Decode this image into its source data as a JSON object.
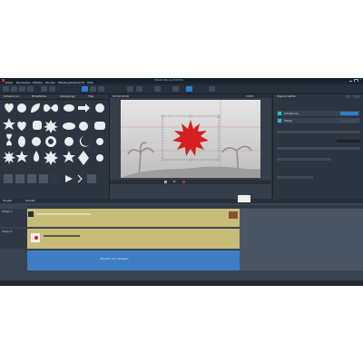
{
  "window": {
    "title": "MAGIX Movie Edit Pro"
  },
  "menu": {
    "items": [
      "Datei",
      "Bearbeiten",
      "Effekte",
      "Fenster",
      "Wiedergabe",
      "Ansicht",
      "Hilfe"
    ]
  },
  "toolbar": {
    "active_tool": "Titel"
  },
  "left_panel": {
    "tabs": [
      "Schablonen",
      "Bildeffekte",
      "Übergänge",
      "Titel"
    ],
    "shapes": [
      "heart",
      "circle",
      "leaf",
      "butterfly",
      "blob",
      "arrow",
      "star",
      "sun",
      "cloud",
      "flower",
      "ring",
      "moon",
      "rosette",
      "burst"
    ]
  },
  "viewer": {
    "zoom_label": "100%",
    "timecode": "00:00:00:00"
  },
  "right_panel": {
    "title": "Eigenschaften",
    "items": [
      "Schablone",
      "Maske"
    ],
    "buttons": [
      "Anwenden",
      "Zurücksetzen"
    ]
  },
  "timeline": {
    "tabs": [
      "Projekt",
      "Schnitt"
    ],
    "track1_label": "Video 1",
    "track2_label": "Video 2",
    "status_text": "Objekte hier ablegen"
  },
  "colors": {
    "accent": "#2b7fd0",
    "burst": "#d42020",
    "clip": "#c7bd78"
  }
}
